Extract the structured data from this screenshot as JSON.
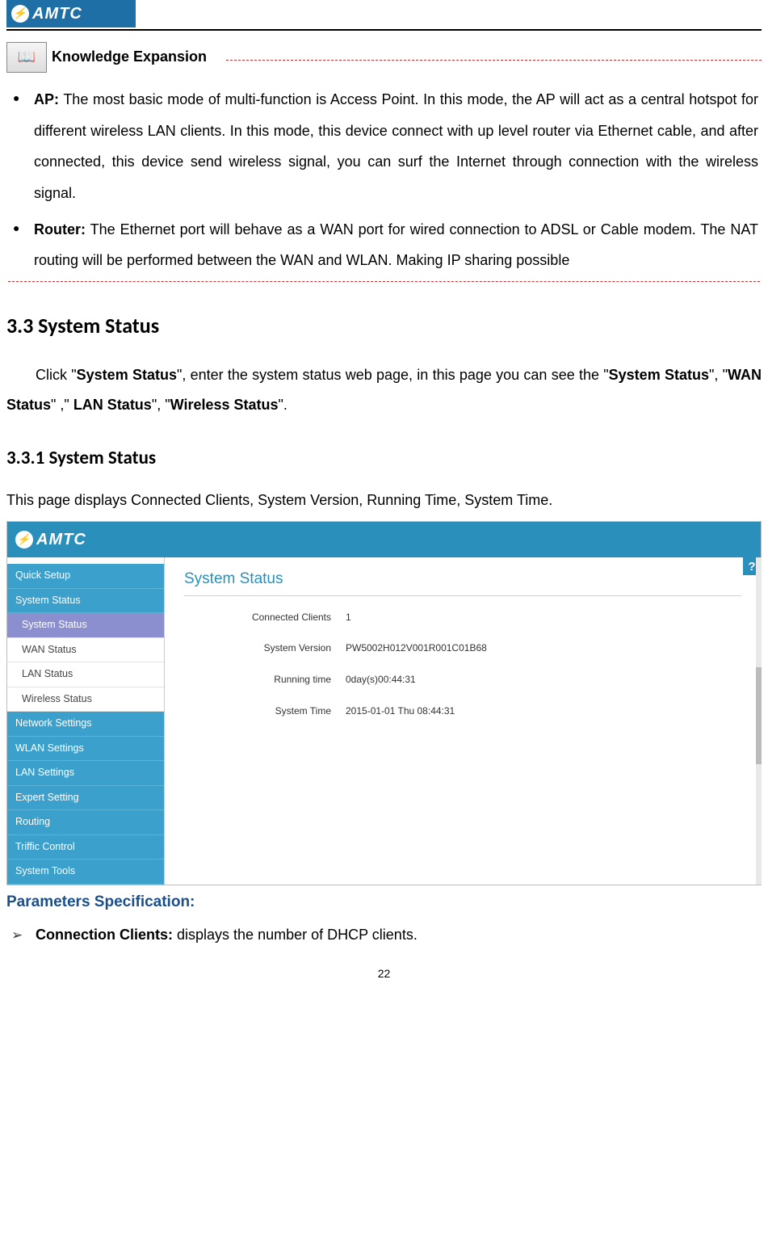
{
  "header": {
    "brand": "AMTC"
  },
  "knowledge": {
    "title": "Knowledge Expansion",
    "items": [
      {
        "label": "AP:",
        "text": "The most basic mode of multi-function is Access Point. In this mode, the AP will act as a central hotspot for different wireless LAN clients. In this mode, this device connect with up level router via Ethernet cable, and after connected, this device send wireless signal, you can surf the Internet through connection with the wireless signal."
      },
      {
        "label": "Router:",
        "text": "The Ethernet port will behave as a WAN port for wired connection to ADSL or Cable modem. The NAT routing will be performed between the WAN and WLAN. Making IP sharing possible"
      }
    ]
  },
  "section": {
    "heading": "3.3 System Status",
    "intro_prefix": "Click \"",
    "intro_bold1": "System Status",
    "intro_mid1": "\", enter the system status web page, in this page you can see the \"",
    "intro_bold2": "System Status",
    "intro_mid2": "\", \"",
    "intro_bold3": "WAN Status",
    "intro_mid3": "\" ,\" ",
    "intro_bold4": "LAN Status",
    "intro_mid4": "\", \"",
    "intro_bold5": "Wireless Status",
    "intro_end": "\"."
  },
  "subsection": {
    "heading": "3.3.1 System Status",
    "desc": "This page displays Connected Clients, System Version, Running Time, System Time."
  },
  "ui": {
    "brand": "AMTC",
    "help": "?",
    "title": "System Status",
    "sidebar_top": [
      "Quick Setup",
      "System Status"
    ],
    "sidebar_sub": [
      "System Status",
      "WAN Status",
      "LAN Status",
      "Wireless Status"
    ],
    "sidebar_bottom": [
      "Network Settings",
      "WLAN Settings",
      "LAN Settings",
      "Expert Setting",
      "Routing",
      "Triffic Control",
      "System Tools"
    ],
    "rows": [
      {
        "k": "Connected Clients",
        "v": "1"
      },
      {
        "k": "System Version",
        "v": "PW5002H012V001R001C01B68"
      },
      {
        "k": "Running time",
        "v": "0day(s)00:44:31"
      },
      {
        "k": "System Time",
        "v": "2015-01-01 Thu 08:44:31"
      }
    ]
  },
  "params": {
    "title": "Parameters Specification:",
    "items": [
      {
        "label": "Connection Clients:",
        "text": "displays the number of DHCP clients."
      }
    ]
  },
  "page_number": "22"
}
